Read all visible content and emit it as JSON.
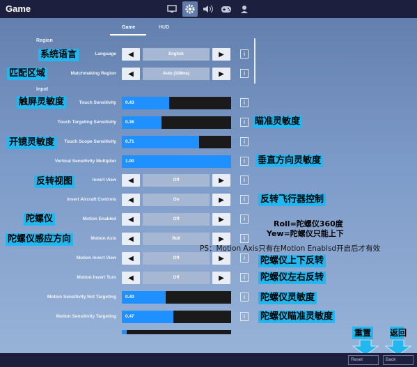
{
  "app": {
    "title": "Game"
  },
  "top_icons": [
    "monitor-icon",
    "gear-icon",
    "speaker-icon",
    "gamepad-icon",
    "user-icon"
  ],
  "subtabs": [
    "Game",
    "HUD"
  ],
  "sections": {
    "region": "Region",
    "input": "Input"
  },
  "rows": {
    "language": {
      "label": "Language",
      "value": "English"
    },
    "matchmaking": {
      "label": "Matchmaking Region",
      "value": "Auto (108ms)"
    },
    "touch_sens": {
      "label": "Touch Sensitivity",
      "value": "0.43",
      "fill": 0.43
    },
    "touch_target": {
      "label": "Touch Targeting Sensitivity",
      "value": "0.36",
      "fill": 0.36
    },
    "touch_scope": {
      "label": "Touch Scope Sensitivity",
      "value": "0.71",
      "fill": 0.71
    },
    "vert_mult": {
      "label": "Vertical Sensitivity Multiplier",
      "value": "1.00",
      "fill": 1.0
    },
    "invert_view": {
      "label": "Invert View",
      "value": "Off"
    },
    "invert_aircraft": {
      "label": "Invert Aircraft Controls",
      "value": "On"
    },
    "motion_enabled": {
      "label": "Motion Enabled",
      "value": "Off"
    },
    "motion_axis": {
      "label": "Motion Axis",
      "value": "Roll"
    },
    "motion_invert_view": {
      "label": "Motion Invert View",
      "value": "Off"
    },
    "motion_invert_turn": {
      "label": "Motion Invert Turn",
      "value": "Off"
    },
    "motion_sens": {
      "label": "Motion Sensitivity Not Targeting",
      "value": "0.40",
      "fill": 0.4
    },
    "motion_sens_t": {
      "label": "Motion Sensitivity Targeting",
      "value": "0.47",
      "fill": 0.47
    }
  },
  "annotations": {
    "system_language": "系统语言",
    "match_region": "匹配区域",
    "touch_sens": "触屏灵敏度",
    "aim_sens": "瞄准灵敏度",
    "scope_sens": "开镜灵敏度",
    "vertical_sens": "垂直方向灵敏度",
    "invert_view": "反转视图",
    "invert_aircraft": "反转飞行器控制",
    "gyro": "陀螺仪",
    "roll_note": "Roll=陀螺仪360度",
    "yew_note": "Yew=陀螺仪只能上下",
    "gyro_direction": "陀螺仪感应方向",
    "ps_note": "PS：Motion Axis只有在Motion Enablsd开启后才有效",
    "gyro_updown": "陀螺仪上下反转",
    "gyro_leftright": "陀螺仪左右反转",
    "gyro_sens": "陀螺仪灵敏度",
    "gyro_aim_sens": "陀螺仪瞄准灵敏度",
    "reset_cn": "重置",
    "back_cn": "返回"
  },
  "bottom": {
    "reset": "Reset",
    "back": "Back"
  },
  "colors": {
    "accent": "#1e90ff",
    "annotation": "#22b7ef",
    "bar": "#1d1f3f"
  }
}
